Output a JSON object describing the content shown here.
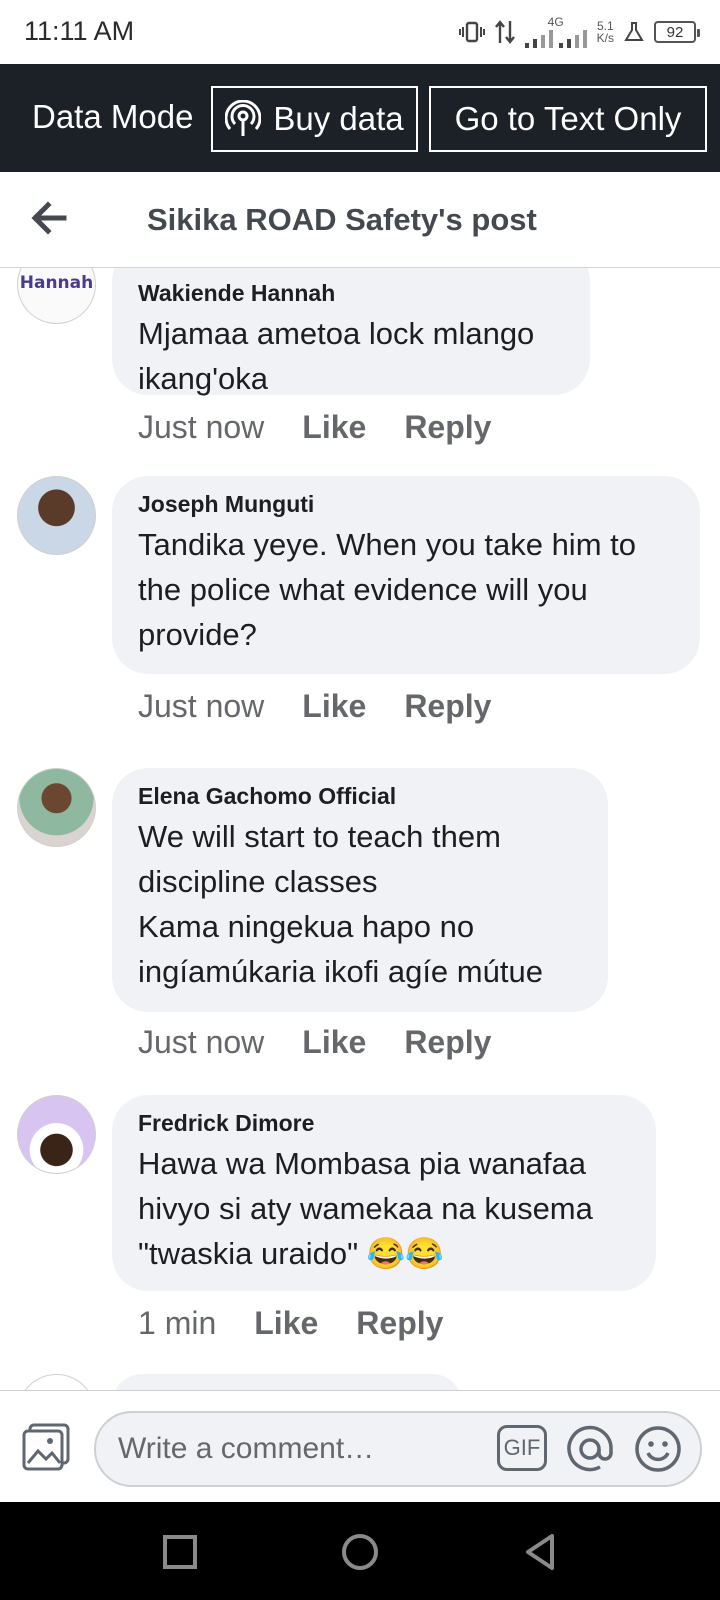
{
  "status_bar": {
    "time": "11:11 AM",
    "network": "4G",
    "speed_value": "5.1",
    "speed_unit": "K/s",
    "battery": "92"
  },
  "data_banner": {
    "label": "Data Mode",
    "buy_data": "Buy data",
    "text_only": "Go to Text Only"
  },
  "header": {
    "title": "Sikika ROAD Safety's post"
  },
  "comments": [
    {
      "name": "Wakiende Hannah",
      "text": "Mjamaa ametoa lock mlango\nikang'oka",
      "time": "Just now",
      "like": "Like",
      "reply": "Reply",
      "avatar_label": "Hannah"
    },
    {
      "name": "Joseph Munguti",
      "text": "Tandika yeye. When you take him to\nthe police what evidence will you\nprovide?",
      "time": "Just now",
      "like": "Like",
      "reply": "Reply"
    },
    {
      "name": "Elena Gachomo Official",
      "text": "We will start to teach them\ndiscipline classes\nKama ningekua hapo no\ningíamúkaria ikofi agíe mútue",
      "time": "Just now",
      "like": "Like",
      "reply": "Reply"
    },
    {
      "name": "Fredrick Dimore",
      "text": "Hawa wa Mombasa pia wanafaa\nhivyo si aty wamekaa na kusema\n\"twaskia uraido\" 😂😂",
      "time": "1 min",
      "like": "Like",
      "reply": "Reply"
    }
  ],
  "composer": {
    "placeholder": "Write a comment…",
    "gif": "GIF"
  },
  "colors": {
    "banner_bg": "#1c2128",
    "bubble_bg": "#f0f2f5",
    "meta_gray": "#65676b"
  }
}
